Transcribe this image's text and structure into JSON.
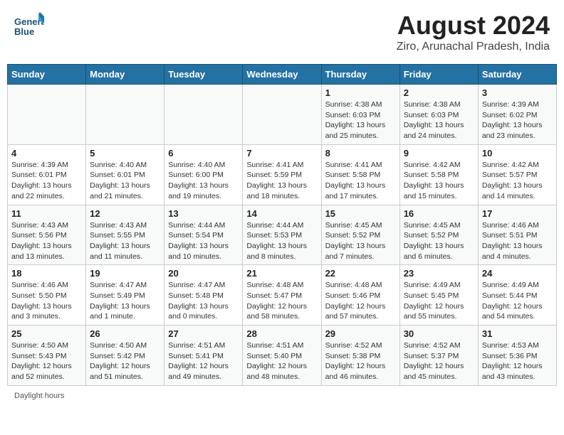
{
  "logo": {
    "line1": "General",
    "line2": "Blue"
  },
  "title": "August 2024",
  "subtitle": "Ziro, Arunachal Pradesh, India",
  "days_of_week": [
    "Sunday",
    "Monday",
    "Tuesday",
    "Wednesday",
    "Thursday",
    "Friday",
    "Saturday"
  ],
  "weeks": [
    [
      {
        "num": "",
        "detail": ""
      },
      {
        "num": "",
        "detail": ""
      },
      {
        "num": "",
        "detail": ""
      },
      {
        "num": "",
        "detail": ""
      },
      {
        "num": "1",
        "detail": "Sunrise: 4:38 AM\nSunset: 6:03 PM\nDaylight: 13 hours and 25 minutes."
      },
      {
        "num": "2",
        "detail": "Sunrise: 4:38 AM\nSunset: 6:03 PM\nDaylight: 13 hours and 24 minutes."
      },
      {
        "num": "3",
        "detail": "Sunrise: 4:39 AM\nSunset: 6:02 PM\nDaylight: 13 hours and 23 minutes."
      }
    ],
    [
      {
        "num": "4",
        "detail": "Sunrise: 4:39 AM\nSunset: 6:01 PM\nDaylight: 13 hours and 22 minutes."
      },
      {
        "num": "5",
        "detail": "Sunrise: 4:40 AM\nSunset: 6:01 PM\nDaylight: 13 hours and 21 minutes."
      },
      {
        "num": "6",
        "detail": "Sunrise: 4:40 AM\nSunset: 6:00 PM\nDaylight: 13 hours and 19 minutes."
      },
      {
        "num": "7",
        "detail": "Sunrise: 4:41 AM\nSunset: 5:59 PM\nDaylight: 13 hours and 18 minutes."
      },
      {
        "num": "8",
        "detail": "Sunrise: 4:41 AM\nSunset: 5:58 PM\nDaylight: 13 hours and 17 minutes."
      },
      {
        "num": "9",
        "detail": "Sunrise: 4:42 AM\nSunset: 5:58 PM\nDaylight: 13 hours and 15 minutes."
      },
      {
        "num": "10",
        "detail": "Sunrise: 4:42 AM\nSunset: 5:57 PM\nDaylight: 13 hours and 14 minutes."
      }
    ],
    [
      {
        "num": "11",
        "detail": "Sunrise: 4:43 AM\nSunset: 5:56 PM\nDaylight: 13 hours and 13 minutes."
      },
      {
        "num": "12",
        "detail": "Sunrise: 4:43 AM\nSunset: 5:55 PM\nDaylight: 13 hours and 11 minutes."
      },
      {
        "num": "13",
        "detail": "Sunrise: 4:44 AM\nSunset: 5:54 PM\nDaylight: 13 hours and 10 minutes."
      },
      {
        "num": "14",
        "detail": "Sunrise: 4:44 AM\nSunset: 5:53 PM\nDaylight: 13 hours and 8 minutes."
      },
      {
        "num": "15",
        "detail": "Sunrise: 4:45 AM\nSunset: 5:52 PM\nDaylight: 13 hours and 7 minutes."
      },
      {
        "num": "16",
        "detail": "Sunrise: 4:45 AM\nSunset: 5:52 PM\nDaylight: 13 hours and 6 minutes."
      },
      {
        "num": "17",
        "detail": "Sunrise: 4:46 AM\nSunset: 5:51 PM\nDaylight: 13 hours and 4 minutes."
      }
    ],
    [
      {
        "num": "18",
        "detail": "Sunrise: 4:46 AM\nSunset: 5:50 PM\nDaylight: 13 hours and 3 minutes."
      },
      {
        "num": "19",
        "detail": "Sunrise: 4:47 AM\nSunset: 5:49 PM\nDaylight: 13 hours and 1 minute."
      },
      {
        "num": "20",
        "detail": "Sunrise: 4:47 AM\nSunset: 5:48 PM\nDaylight: 13 hours and 0 minutes."
      },
      {
        "num": "21",
        "detail": "Sunrise: 4:48 AM\nSunset: 5:47 PM\nDaylight: 12 hours and 58 minutes."
      },
      {
        "num": "22",
        "detail": "Sunrise: 4:48 AM\nSunset: 5:46 PM\nDaylight: 12 hours and 57 minutes."
      },
      {
        "num": "23",
        "detail": "Sunrise: 4:49 AM\nSunset: 5:45 PM\nDaylight: 12 hours and 55 minutes."
      },
      {
        "num": "24",
        "detail": "Sunrise: 4:49 AM\nSunset: 5:44 PM\nDaylight: 12 hours and 54 minutes."
      }
    ],
    [
      {
        "num": "25",
        "detail": "Sunrise: 4:50 AM\nSunset: 5:43 PM\nDaylight: 12 hours and 52 minutes."
      },
      {
        "num": "26",
        "detail": "Sunrise: 4:50 AM\nSunset: 5:42 PM\nDaylight: 12 hours and 51 minutes."
      },
      {
        "num": "27",
        "detail": "Sunrise: 4:51 AM\nSunset: 5:41 PM\nDaylight: 12 hours and 49 minutes."
      },
      {
        "num": "28",
        "detail": "Sunrise: 4:51 AM\nSunset: 5:40 PM\nDaylight: 12 hours and 48 minutes."
      },
      {
        "num": "29",
        "detail": "Sunrise: 4:52 AM\nSunset: 5:38 PM\nDaylight: 12 hours and 46 minutes."
      },
      {
        "num": "30",
        "detail": "Sunrise: 4:52 AM\nSunset: 5:37 PM\nDaylight: 12 hours and 45 minutes."
      },
      {
        "num": "31",
        "detail": "Sunrise: 4:53 AM\nSunset: 5:36 PM\nDaylight: 12 hours and 43 minutes."
      }
    ]
  ],
  "footer": "Daylight hours"
}
